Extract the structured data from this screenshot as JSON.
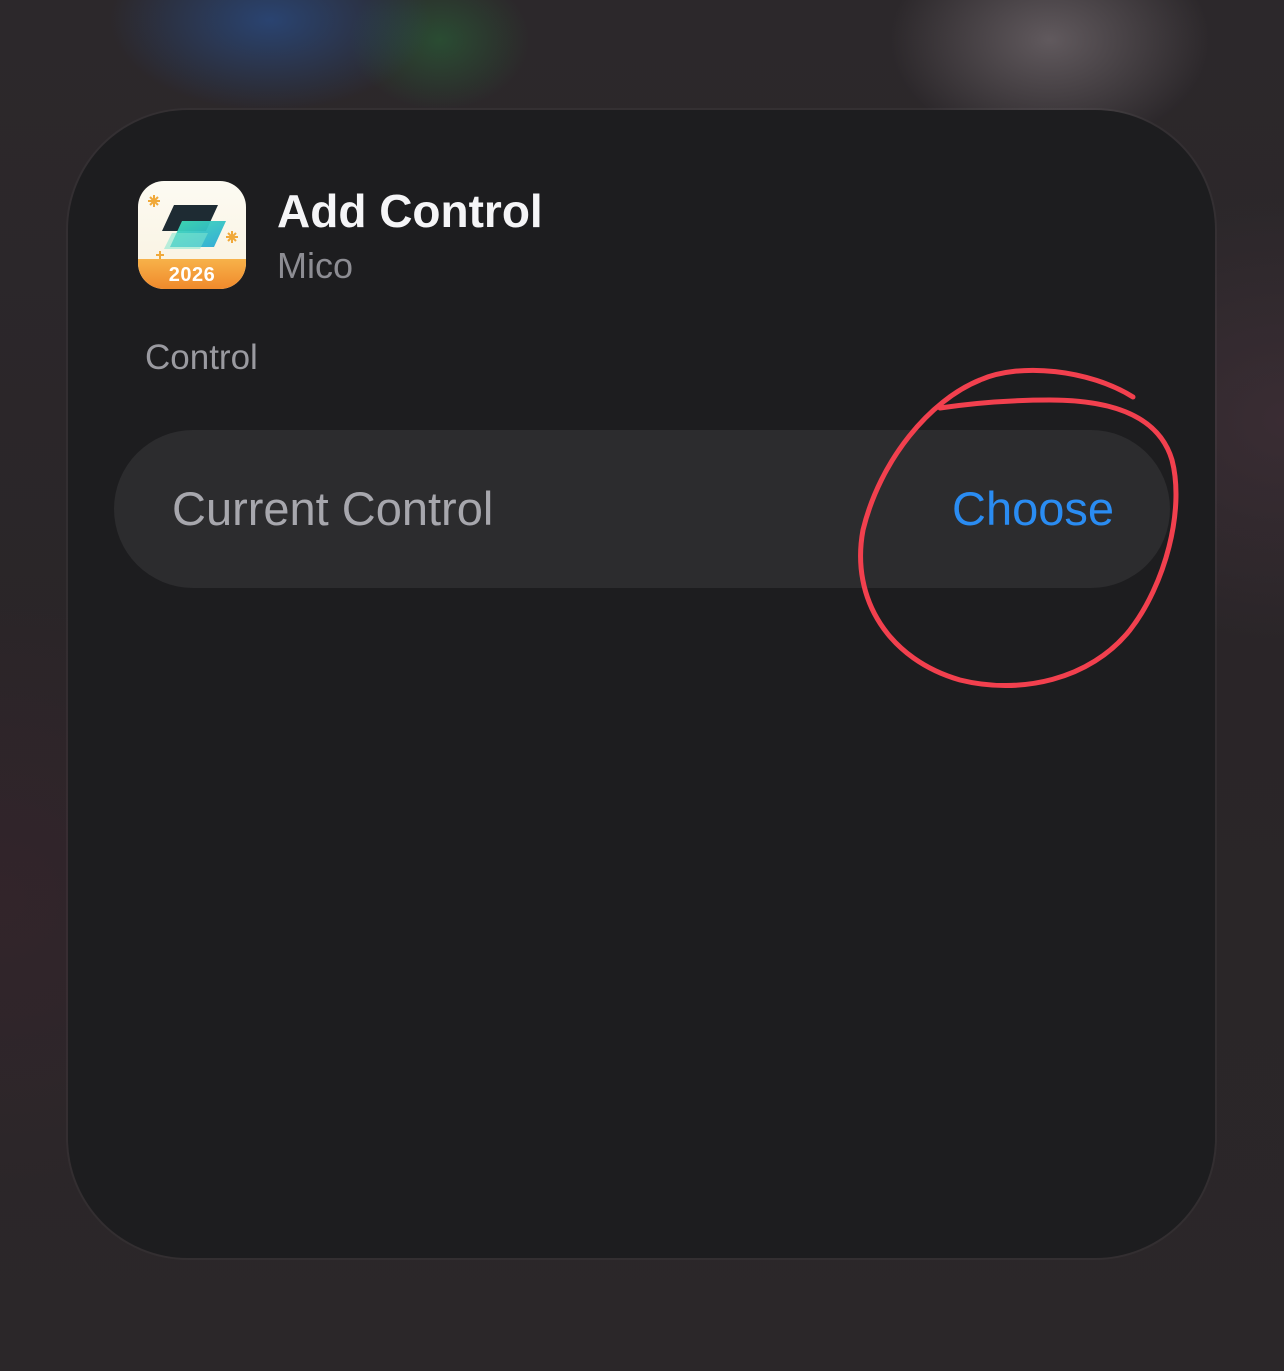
{
  "app": {
    "icon": "mico-app-icon",
    "icon_year": "2026"
  },
  "sheet": {
    "title": "Add Control",
    "subtitle": "Mico",
    "section_label": "Control"
  },
  "control_row": {
    "label": "Current Control",
    "action_label": "Choose"
  },
  "colors": {
    "card_background": "#1d1d1f",
    "row_background": "#2c2c2e",
    "accent_blue": "#2a8cf2",
    "annotation_red": "#f2404e"
  }
}
